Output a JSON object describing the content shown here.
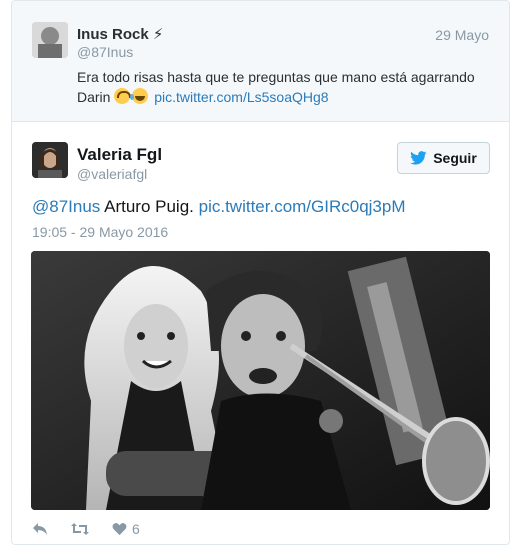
{
  "parent_tweet": {
    "author_name": "Inus Rock ⚡",
    "handle": "@87Inus",
    "date": "29 Mayo",
    "text": "Era todo risas hasta que te preguntas que mano está agarrando Darin",
    "link": "pic.twitter.com/Ls5soaQHg8"
  },
  "tweet": {
    "author_name": "Valeria Fgl",
    "handle": "@valeriafgl",
    "follow_label": "Seguir",
    "mention": "@87Inus",
    "text": "Arturo Puig.",
    "link": "pic.twitter.com/GIRc0qj3pM",
    "timestamp": "19:05 - 29 Mayo 2016",
    "like_count": "6"
  },
  "icons": [
    "reply-icon",
    "retweet-icon",
    "heart-icon",
    "twitter-bird-icon"
  ],
  "colors": {
    "link": "#2b7bb9",
    "muted": "#8899a6",
    "brand": "#1da1f2",
    "parent_bg": "#f5f8fa"
  }
}
